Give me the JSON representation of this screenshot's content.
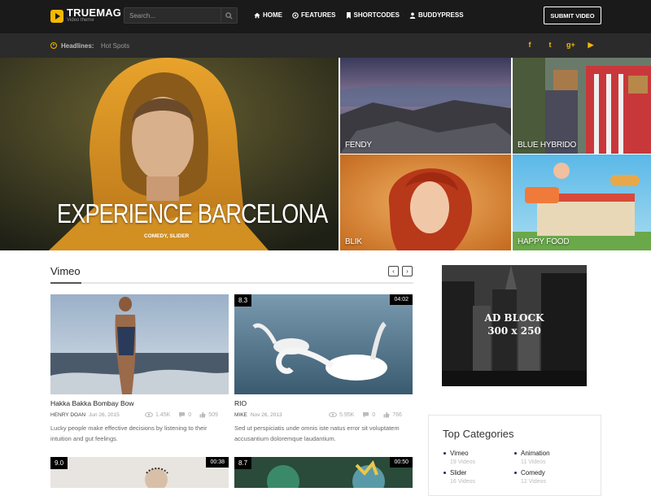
{
  "header": {
    "logo_name": "TRUEMAG",
    "logo_tagline": "Video theme",
    "search_placeholder": "Search...",
    "nav": [
      {
        "label": "HOME",
        "icon": "home-icon"
      },
      {
        "label": "FEATURES",
        "icon": "features-icon"
      },
      {
        "label": "SHORTCODES",
        "icon": "bookmark-icon"
      },
      {
        "label": "BUDDYPRESS",
        "icon": "user-icon"
      }
    ],
    "submit_label": "SUBMIT VIDEO"
  },
  "headlines": {
    "label": "Headlines:",
    "text": "Hot Spots",
    "social": [
      {
        "icon": "facebook-icon",
        "glyph": "f"
      },
      {
        "icon": "twitter-icon",
        "glyph": "t"
      },
      {
        "icon": "google-plus-icon",
        "glyph": "g+"
      },
      {
        "icon": "youtube-icon",
        "glyph": "▶"
      }
    ]
  },
  "featured": {
    "main": {
      "title": "EXPERIENCE BARCELONA",
      "categories": "COMEDY, SLIDER"
    },
    "tiles": [
      {
        "title": "FENDY"
      },
      {
        "title": "BLUE HYBRIDO"
      },
      {
        "title": "BLIK"
      },
      {
        "title": "HAPPY FOOD"
      }
    ]
  },
  "section": {
    "title": "Vimeo",
    "prev": "‹",
    "next": "›"
  },
  "cards": [
    {
      "title": "Hakka Bakka Bombay Bow",
      "author": "HENRY DOAN",
      "date": "Jun 26, 2015",
      "views": "1.45K",
      "comments": "0",
      "likes": "509",
      "description": "Lucky people make effective decisions by listening to their intuition and gut feelings."
    },
    {
      "title": "RIO",
      "score": "8.3",
      "duration": "04:02",
      "author": "MIKE",
      "date": "Nov 26, 2013",
      "views": "5.95K",
      "comments": "0",
      "likes": "766",
      "description": "Sed ut perspiciatis unde omnis iste natus error sit voluptatem accusantium doloremque laudantium."
    },
    {
      "score": "9.0",
      "duration": "00:38"
    },
    {
      "score": "8.7",
      "duration": "00:50"
    }
  ],
  "ad": {
    "line1": "AD BLOCK",
    "line2": "300 x 250"
  },
  "top_categories": {
    "title": "Top Categories",
    "items": [
      {
        "name": "Vimeo",
        "count": "19 Videos"
      },
      {
        "name": "Animation",
        "count": "11 Videos"
      },
      {
        "name": "Slider",
        "count": "16 Videos"
      },
      {
        "name": "Comedy",
        "count": "12 Videos"
      }
    ]
  },
  "colors": {
    "accent": "#f5b800",
    "topbar": "#1a1a1a",
    "headbar": "#2b2b2b"
  }
}
